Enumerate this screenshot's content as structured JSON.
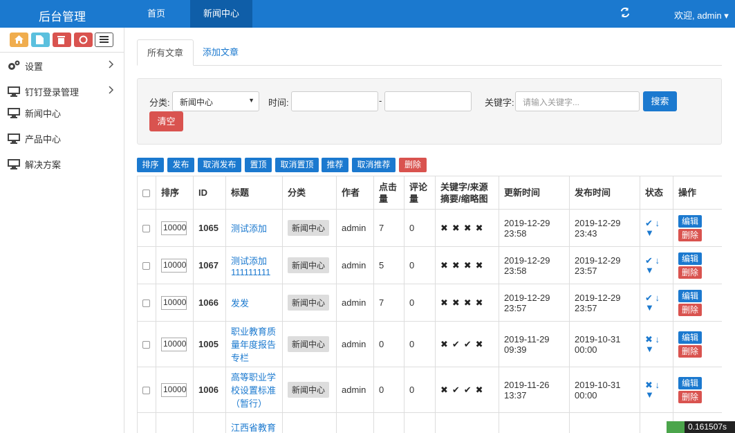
{
  "header": {
    "brand": "后台管理",
    "nav": [
      "首页",
      "新闻中心"
    ],
    "welcome": "欢迎, admin ▾"
  },
  "sidebar": {
    "items": [
      {
        "label": "设置",
        "icon": "gears-icon",
        "has_sub": true
      },
      {
        "label": "钉钉登录管理",
        "icon": "monitor-icon",
        "has_sub": true
      },
      {
        "label": "新闻中心",
        "icon": "monitor-icon",
        "has_sub": false
      },
      {
        "label": "产品中心",
        "icon": "monitor-icon",
        "has_sub": false
      },
      {
        "label": "解决方案",
        "icon": "monitor-icon",
        "has_sub": false
      }
    ]
  },
  "tabs": [
    "所有文章",
    "添加文章"
  ],
  "filter": {
    "category_label": "分类:",
    "category_value": "新闻中心",
    "time_label": "时间:",
    "dash": "-",
    "keyword_label": "关键字:",
    "keyword_placeholder": "请输入关键字...",
    "search_button": "搜索",
    "clear_button": "清空"
  },
  "actions": [
    "排序",
    "发布",
    "取消发布",
    "置顶",
    "取消置顶",
    "推荐",
    "取消推荐",
    "删除"
  ],
  "table": {
    "headers": [
      "排序",
      "ID",
      "标题",
      "分类",
      "作者",
      "点击量",
      "评论量",
      "关键字/来源摘要/缩略图",
      "更新时间",
      "发布时间",
      "状态",
      "操作"
    ],
    "rows": [
      {
        "sort": "10000",
        "id": "1065",
        "title": "测试添加",
        "category": "新闻中心",
        "author": "admin",
        "clicks": "7",
        "comments": "0",
        "flags": "✖✖✖✖",
        "updated": "2019-12-29 23:58",
        "published": "2019-12-29 23:43",
        "status": "✔ ↓",
        "edit": "编辑",
        "delete": "删除"
      },
      {
        "sort": "10000",
        "id": "1067",
        "title": "测试添加111111111",
        "category": "新闻中心",
        "author": "admin",
        "clicks": "5",
        "comments": "0",
        "flags": "✖✖✖✖",
        "updated": "2019-12-29 23:58",
        "published": "2019-12-29 23:57",
        "status": "✔ ↓",
        "edit": "编辑",
        "delete": "删除"
      },
      {
        "sort": "10000",
        "id": "1066",
        "title": "发发",
        "category": "新闻中心",
        "author": "admin",
        "clicks": "7",
        "comments": "0",
        "flags": "✖✖✖✖",
        "updated": "2019-12-29 23:57",
        "published": "2019-12-29 23:57",
        "status": "✔ ↓",
        "edit": "编辑",
        "delete": "删除"
      },
      {
        "sort": "10000",
        "id": "1005",
        "title": "职业教育质量年度报告专栏",
        "category": "新闻中心",
        "author": "admin",
        "clicks": "0",
        "comments": "0",
        "flags": "✖✔✔✖",
        "updated": "2019-11-29 09:39",
        "published": "2019-10-31 00:00",
        "status": "✖ ↓",
        "edit": "编辑",
        "delete": "删除"
      },
      {
        "sort": "10000",
        "id": "1006",
        "title": "高等职业学校设置标准（暂行）",
        "category": "新闻中心",
        "author": "admin",
        "clicks": "0",
        "comments": "0",
        "flags": "✖✔✔✖",
        "updated": "2019-11-26 13:37",
        "published": "2019-10-31 00:00",
        "status": "✖ ↓",
        "edit": "编辑",
        "delete": "删除"
      },
      {
        "sort": "",
        "id": "",
        "title": "江西省教育厅 江西省",
        "category": "",
        "author": "",
        "clicks": "",
        "comments": "",
        "flags": "",
        "updated": "",
        "published": "",
        "status": "",
        "edit": "",
        "delete": ""
      }
    ]
  },
  "timer": "0.161507s",
  "colors": {
    "primary": "#1b79cf",
    "danger": "#d9534f",
    "orange": "#f0ad4e",
    "teal": "#5bc0de"
  }
}
